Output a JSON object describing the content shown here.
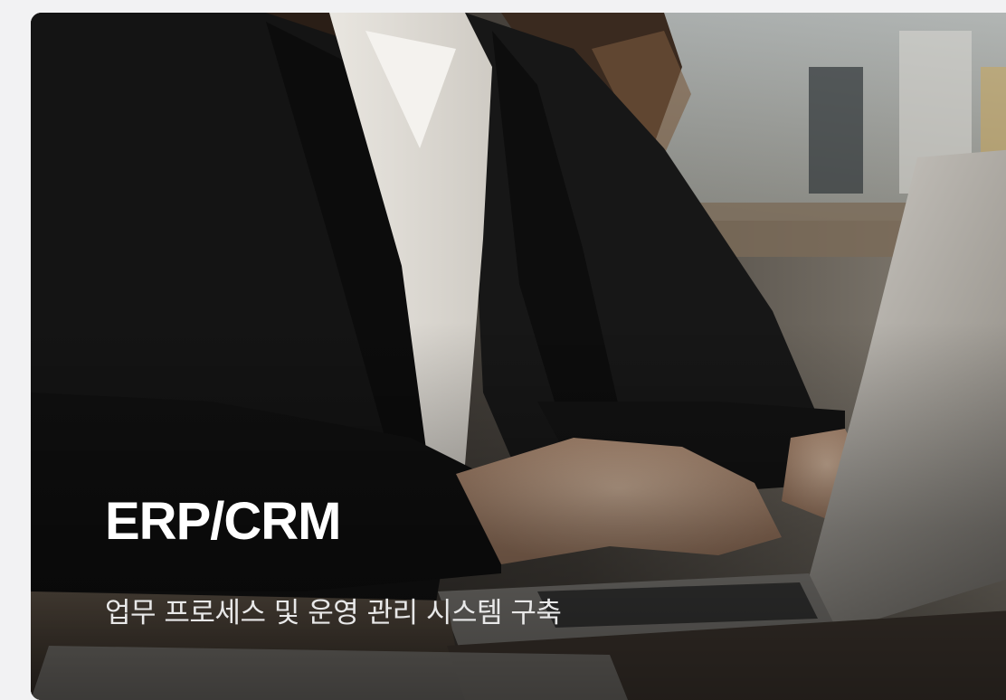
{
  "card": {
    "title": "ERP/CRM",
    "subtitle": "업무 프로세스 및 운영 관리 시스템 구축",
    "image_subject": "person-typing-on-laptop-photo"
  },
  "colors": {
    "page_background": "#f2f2f3",
    "title_text": "#ffffff",
    "subtitle_text": "#e8e8e8"
  }
}
